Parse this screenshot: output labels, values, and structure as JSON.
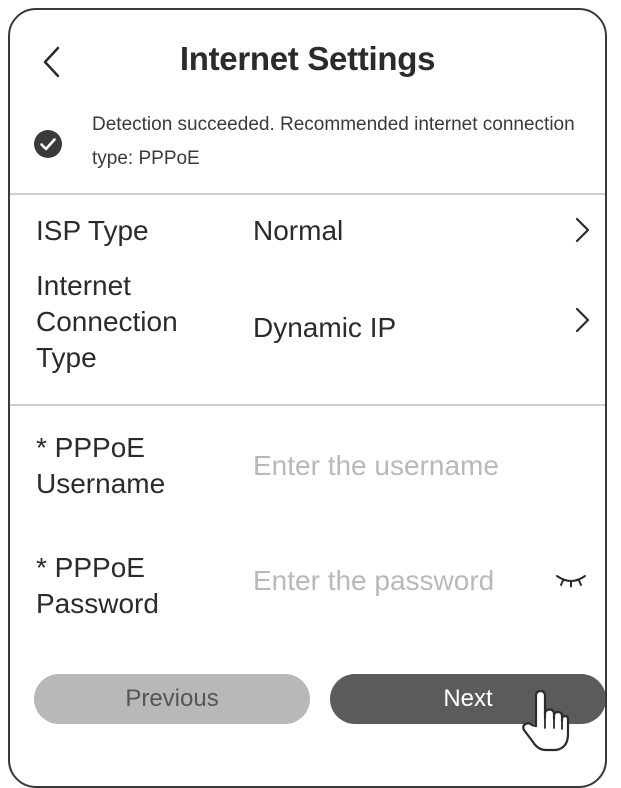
{
  "header": {
    "title": "Internet Settings"
  },
  "banner": {
    "message": "Detection succeeded. Recommended internet connection type: PPPoE"
  },
  "settings": {
    "isp_type": {
      "label": "ISP Type",
      "value": "Normal"
    },
    "connection_type": {
      "label_lines": [
        "Internet",
        "Connection",
        "Type"
      ],
      "value": "Dynamic IP"
    }
  },
  "credentials": {
    "username": {
      "label_lines": [
        "* PPPoE",
        "Username"
      ],
      "placeholder": "Enter the username",
      "value": ""
    },
    "password": {
      "label_lines": [
        "* PPPoE",
        "Password"
      ],
      "placeholder": "Enter the password",
      "value": ""
    }
  },
  "buttons": {
    "previous": "Previous",
    "next": "Next"
  },
  "icons": {
    "back": "chevron-left-icon",
    "status": "check-circle-icon",
    "isp_type_arrow": "chevron-right-icon",
    "connection_type_arrow": "chevron-right-icon",
    "password_visibility": "eye-closed-icon",
    "cursor": "hand-pointer-icon"
  },
  "colors": {
    "previous_button_bg": "#b8b8b8",
    "next_button_bg": "#5b5b5b",
    "check_icon": "#3a3a3a",
    "divider": "#cfcfcf",
    "placeholder": "#b9b9b9"
  }
}
